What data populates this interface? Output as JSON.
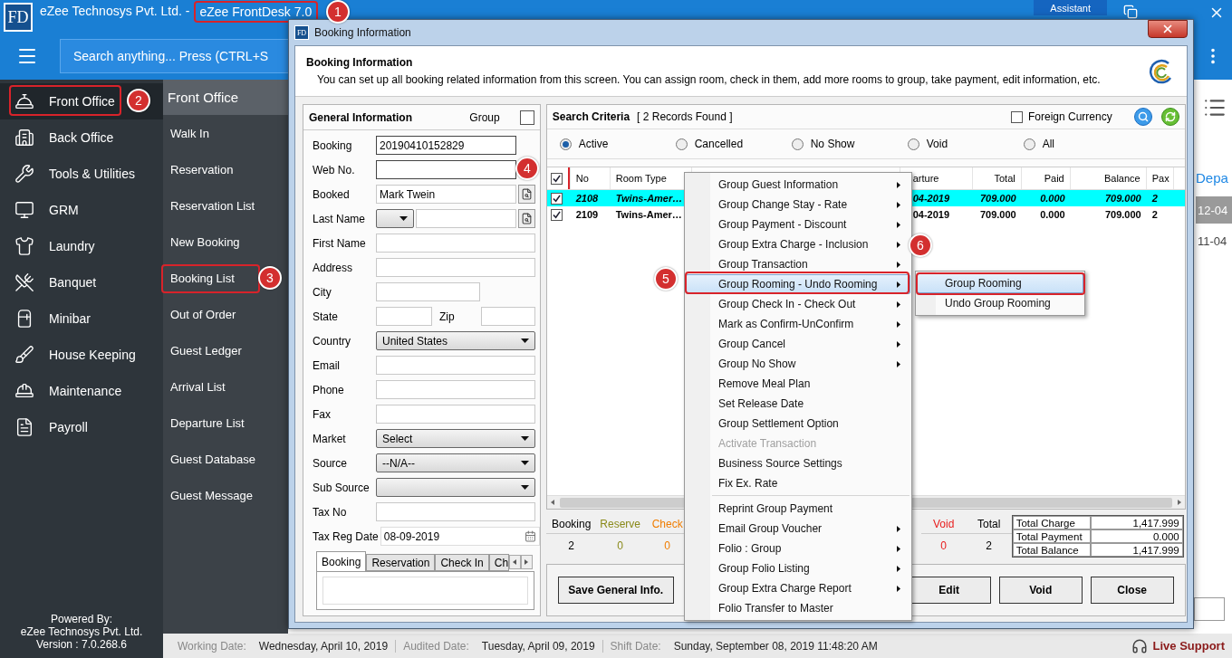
{
  "app": {
    "logo": "FD",
    "company": "eZee Technosys Pvt. Ltd. -",
    "product": "eZee FrontDesk 7.0",
    "assistant": "Assistant",
    "search_placeholder": "Search anything... Press (CTRL+S"
  },
  "sidebar": {
    "items": [
      {
        "label": "Front Office",
        "selected": true
      },
      {
        "label": "Back Office",
        "selected": false
      },
      {
        "label": "Tools & Utilities",
        "selected": false
      },
      {
        "label": "GRM",
        "selected": false
      },
      {
        "label": "Laundry",
        "selected": false
      },
      {
        "label": "Banquet",
        "selected": false
      },
      {
        "label": "Minibar",
        "selected": false
      },
      {
        "label": "House Keeping",
        "selected": false
      },
      {
        "label": "Maintenance",
        "selected": false
      },
      {
        "label": "Payroll",
        "selected": false
      }
    ],
    "footer": [
      "Powered By:",
      "eZee Technosys Pvt. Ltd.",
      "Version : 7.0.268.6"
    ]
  },
  "submenu": {
    "title": "Front Office",
    "items": [
      "Walk In",
      "Reservation",
      "Reservation List",
      "New Booking",
      "Booking List",
      "Out of Order",
      "Guest Ledger",
      "Arrival List",
      "Departure List",
      "Guest Database",
      "Guest Message"
    ]
  },
  "background_list": {
    "column_header": "Depa",
    "rows": [
      {
        "value": "12-04",
        "selected": true
      },
      {
        "value": "11-04",
        "selected": false
      }
    ]
  },
  "status_bar": [
    {
      "label": "Working Date:",
      "value": "Wednesday, April 10, 2019"
    },
    {
      "label": "Audited Date:",
      "value": "Tuesday, April 09, 2019"
    },
    {
      "label": "Shift Date:",
      "value": "Sunday, September 08, 2019 11:48:20 AM"
    }
  ],
  "live_support": "Live Support",
  "dialog": {
    "icon": "FD",
    "title": "Booking Information",
    "header_title": "Booking Information",
    "description": "You can set up all booking related information from this screen. You can assign room, check in them, add more rooms to group, take payment, edit information, etc.",
    "general": {
      "title": "General Information",
      "group_label": "Group",
      "group_checked": false,
      "fields": [
        {
          "kind": "key",
          "label": "Booking",
          "value": "20190410152829"
        },
        {
          "kind": "key",
          "label": "Web No."
        },
        {
          "kind": "lookup",
          "label": "Booked",
          "value": "Mark Twein"
        },
        {
          "kind": "combo_lookup",
          "label": "Last Name"
        },
        {
          "kind": "text",
          "label": "First Name"
        },
        {
          "kind": "text",
          "label": "Address"
        },
        {
          "kind": "short",
          "label": "City"
        },
        {
          "kind": "pair",
          "label": "State",
          "second_label": "Zip"
        },
        {
          "kind": "select",
          "label": "Country",
          "value": "United States"
        },
        {
          "kind": "text",
          "label": "Email"
        },
        {
          "kind": "text",
          "label": "Phone"
        },
        {
          "kind": "text",
          "label": "Fax"
        },
        {
          "kind": "select",
          "label": "Market",
          "value": "Select"
        },
        {
          "kind": "select",
          "label": "Source",
          "value": "--N/A--"
        },
        {
          "kind": "select",
          "label": "Sub Source"
        },
        {
          "kind": "text",
          "label": "Tax No"
        },
        {
          "kind": "date",
          "label": "Tax Reg Date",
          "value": "08-09-2019"
        }
      ],
      "tabs": [
        {
          "label": "Booking",
          "selected": true
        },
        {
          "label": "Reservation",
          "selected": false
        },
        {
          "label": "Check In",
          "selected": false
        },
        {
          "label": "Ch",
          "selected": false
        }
      ]
    },
    "search": {
      "title": "Search Criteria",
      "records": "[ 2 Records Found ]",
      "foreign_currency": {
        "label": "Foreign Currency",
        "checked": false
      },
      "radios": [
        {
          "label": "Active",
          "selected": true
        },
        {
          "label": "Cancelled",
          "selected": false
        },
        {
          "label": "No Show",
          "selected": false
        },
        {
          "label": "Void",
          "selected": false
        },
        {
          "label": "All",
          "selected": false
        }
      ]
    },
    "grid": {
      "all_checked": true,
      "columns": [
        "No",
        "Room Type",
        "",
        "arture",
        "Total",
        "Paid",
        "Balance",
        "Pax"
      ],
      "rows": [
        {
          "checked": true,
          "selected": true,
          "cells": [
            "2108",
            "Twins-Amer…",
            "",
            "04-2019",
            "709.000",
            "0.000",
            "709.000",
            "2"
          ]
        },
        {
          "checked": true,
          "selected": false,
          "cells": [
            "2109",
            "Twins-Amer…",
            "",
            "04-2019",
            "709.000",
            "0.000",
            "709.000",
            "2"
          ]
        }
      ]
    },
    "summary": {
      "counts_left": [
        {
          "label": "Booking",
          "value": "2",
          "color": "#000000"
        },
        {
          "label": "Reserve",
          "value": "0",
          "color": "#8a8a1a"
        },
        {
          "label": "Check",
          "value": "0",
          "color": "#f07d00"
        }
      ],
      "counts_right": [
        {
          "label": "Void",
          "value": "0",
          "color": "#e81c1c"
        },
        {
          "label": "Total",
          "value": "2",
          "color": "#000000"
        }
      ],
      "totals": [
        {
          "label": "Total Charge",
          "value": "1,417.999"
        },
        {
          "label": "Total Payment",
          "value": "0.000"
        },
        {
          "label": "Total Balance",
          "value": "1,417.999"
        }
      ]
    },
    "buttons_left": [
      "Save General Info."
    ],
    "buttons_right": [
      "Edit",
      "Void",
      "Close"
    ]
  },
  "context_menu": {
    "items": [
      {
        "kind": "item",
        "label": "Group Guest Information",
        "submenu": true,
        "disabled": false,
        "selected": false
      },
      {
        "kind": "item",
        "label": "Group Change Stay - Rate",
        "submenu": true,
        "disabled": false,
        "selected": false
      },
      {
        "kind": "item",
        "label": "Group Payment - Discount",
        "submenu": true,
        "disabled": false,
        "selected": false
      },
      {
        "kind": "item",
        "label": "Group Extra Charge - Inclusion",
        "submenu": true,
        "disabled": false,
        "selected": false
      },
      {
        "kind": "item",
        "label": "Group Transaction",
        "submenu": true,
        "disabled": false,
        "selected": false
      },
      {
        "kind": "item",
        "label": "Group Rooming - Undo Rooming",
        "submenu": true,
        "disabled": false,
        "selected": true
      },
      {
        "kind": "item",
        "label": "Group Check In - Check Out",
        "submenu": true,
        "disabled": false,
        "selected": false
      },
      {
        "kind": "item",
        "label": "Mark as Confirm-UnConfirm",
        "submenu": true,
        "disabled": false,
        "selected": false
      },
      {
        "kind": "item",
        "label": "Group Cancel",
        "submenu": true,
        "disabled": false,
        "selected": false
      },
      {
        "kind": "item",
        "label": "Group No Show",
        "submenu": true,
        "disabled": false,
        "selected": false
      },
      {
        "kind": "item",
        "label": "Remove Meal Plan",
        "submenu": false,
        "disabled": false,
        "selected": false
      },
      {
        "kind": "item",
        "label": "Set Release Date",
        "submenu": false,
        "disabled": false,
        "selected": false
      },
      {
        "kind": "item",
        "label": "Group Settlement Option",
        "submenu": false,
        "disabled": false,
        "selected": false
      },
      {
        "kind": "item",
        "label": "Activate Transaction",
        "submenu": false,
        "disabled": true,
        "selected": false
      },
      {
        "kind": "item",
        "label": "Business Source Settings",
        "submenu": false,
        "disabled": false,
        "selected": false
      },
      {
        "kind": "item",
        "label": "Fix Ex. Rate",
        "submenu": false,
        "disabled": false,
        "selected": false
      },
      {
        "kind": "separator"
      },
      {
        "kind": "item",
        "label": "Reprint Group Payment",
        "submenu": false,
        "disabled": false,
        "selected": false
      },
      {
        "kind": "item",
        "label": "Email Group Voucher",
        "submenu": true,
        "disabled": false,
        "selected": false
      },
      {
        "kind": "item",
        "label": "Folio : Group",
        "submenu": true,
        "disabled": false,
        "selected": false
      },
      {
        "kind": "item",
        "label": "Group Folio Listing",
        "submenu": true,
        "disabled": false,
        "selected": false
      },
      {
        "kind": "item",
        "label": "Group Extra Charge Report",
        "submenu": true,
        "disabled": false,
        "selected": false
      },
      {
        "kind": "item",
        "label": "Folio Transfer to Master",
        "submenu": false,
        "disabled": false,
        "selected": false
      }
    ]
  },
  "rooming_submenu": {
    "items": [
      {
        "label": "Group Rooming",
        "selected": true
      },
      {
        "label": "Undo Group Rooming",
        "selected": false
      }
    ]
  },
  "annotations": [
    {
      "number": "1"
    },
    {
      "number": "2"
    },
    {
      "number": "3"
    },
    {
      "number": "4"
    },
    {
      "number": "5"
    },
    {
      "number": "6"
    }
  ]
}
